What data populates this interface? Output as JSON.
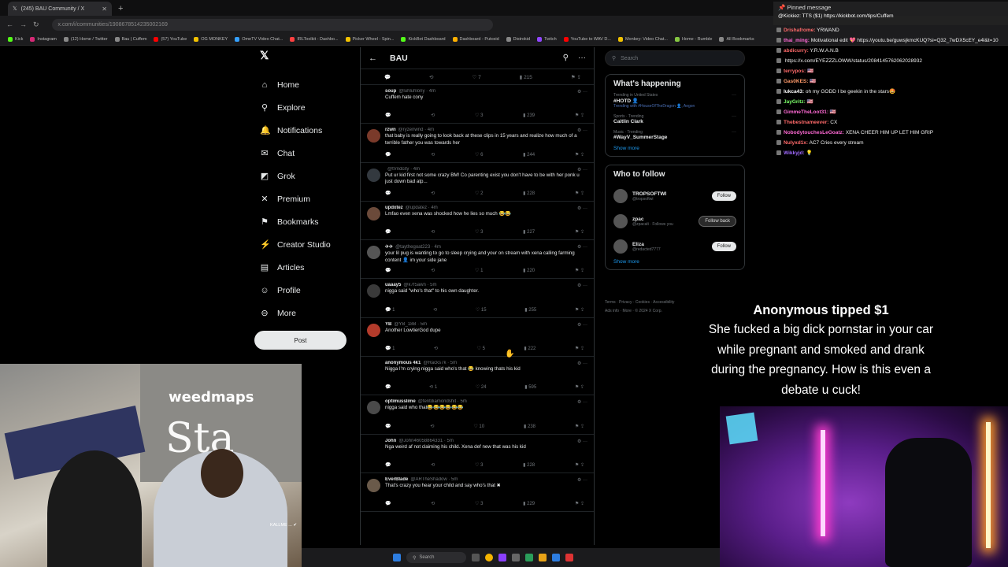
{
  "browser": {
    "tab_title": "(245) BAU Community / X",
    "address": "x.com/i/communities/1908678514235002169",
    "bookmarks": [
      {
        "label": "Kick",
        "color": "#53fc18"
      },
      {
        "label": "Instagram",
        "color": "#d62976"
      },
      {
        "label": "(12) Home / Twitter",
        "color": "#888888"
      },
      {
        "label": "Bau | Cuffem",
        "color": "#888888"
      },
      {
        "label": "(57) YouTube",
        "color": "#ff0000"
      },
      {
        "label": "OG MONKEY",
        "color": "#f2c200"
      },
      {
        "label": "OmeTV Video Chat...",
        "color": "#35a0ff"
      },
      {
        "label": "IRLToolkit - Dashbo...",
        "color": "#ff4040"
      },
      {
        "label": "Picker Wheel - Spin...",
        "color": "#f2c200"
      },
      {
        "label": "KickBot Dashboard",
        "color": "#53fc18"
      },
      {
        "label": "Dashboard - Putoxid",
        "color": "#ffb000"
      },
      {
        "label": "Distrokid",
        "color": "#888888"
      },
      {
        "label": "Twitch",
        "color": "#9146ff"
      },
      {
        "label": "YouTube to WAV D...",
        "color": "#ff0000"
      },
      {
        "label": "Monkey: Video Chat...",
        "color": "#f2c200"
      },
      {
        "label": "Home - Rumble",
        "color": "#85c742"
      },
      {
        "label": "All Bookmarks",
        "color": "#888888"
      }
    ]
  },
  "nav": {
    "items": [
      {
        "label": "Home",
        "icon": "home-icon",
        "glyph": "⌂"
      },
      {
        "label": "Explore",
        "icon": "search-icon",
        "glyph": "⚲"
      },
      {
        "label": "Notifications",
        "icon": "bell-icon",
        "glyph": "🔔"
      },
      {
        "label": "Chat",
        "icon": "chat-icon",
        "glyph": "✉"
      },
      {
        "label": "Grok",
        "icon": "grok-icon",
        "glyph": "◩"
      },
      {
        "label": "Premium",
        "icon": "premium-icon",
        "glyph": "✕"
      },
      {
        "label": "Bookmarks",
        "icon": "bookmark-icon",
        "glyph": "⚑"
      },
      {
        "label": "Creator Studio",
        "icon": "creator-icon",
        "glyph": "⚡"
      },
      {
        "label": "Articles",
        "icon": "articles-icon",
        "glyph": "▤"
      },
      {
        "label": "Profile",
        "icon": "profile-icon",
        "glyph": "☺"
      },
      {
        "label": "More",
        "icon": "more-icon",
        "glyph": "⊖"
      }
    ],
    "post_label": "Post"
  },
  "feed": {
    "title": "BAU",
    "tweets": [
      {
        "name": "soup",
        "handle": "@luhluhlony · 4m",
        "text": "Cuffem hate cony",
        "stats": [
          "",
          "",
          "3",
          "239"
        ],
        "avatar": "#000000"
      },
      {
        "name": "rzwn",
        "handle": "@ryzenwnd · 4m",
        "text": "that baby is really going to look back at these clips in 15 years and realize how much of a terrible father you was towards her",
        "stats": [
          "",
          "",
          "6",
          "244"
        ],
        "avatar": "#7a3a2a"
      },
      {
        "name": "",
        "handle": "@tVndcity · 4m",
        "text": "Put ur kid first not some crazy BM! Co parenting exist you don't have to be with her ponk u just down bad atp...",
        "stats": [
          "",
          "",
          "2",
          "228"
        ],
        "avatar": "#33393f"
      },
      {
        "name": "updxtez",
        "handle": "@updatez · 4m",
        "text": "Lmfao even xena was shocked how he lies so much 😂😂",
        "stats": [
          "",
          "",
          "3",
          "227"
        ],
        "avatar": "#6b4a3a"
      },
      {
        "name": "✈✈",
        "handle": "@taythegoat223 · 4m",
        "text": "your lil pug is wanting to go to sleep crying and your on stream with xena calling farming content 👤 im your side jane",
        "stats": [
          "",
          "",
          "1",
          "220"
        ],
        "avatar": "#555555"
      },
      {
        "name": "uaaay5",
        "handle": "@k7f5awn · 5m",
        "text": "nigga said \"who's that\" to his own daughter.",
        "stats": [
          "1",
          "",
          "15",
          "255"
        ],
        "avatar": "#3a3a3a"
      },
      {
        "name": "YB",
        "handle": "@YB_18B · 5m",
        "text": "Another LowtierGod dupe",
        "stats": [
          "1",
          "",
          "5",
          "222"
        ],
        "avatar": "#b33b2b"
      },
      {
        "name": "anonymous 4k1",
        "handle": "@Racks7k · 5m",
        "text": "Nigga I'm crying nigga said who's that 😂 knowing thats his kid",
        "stats": [
          "",
          "1",
          "24",
          "595"
        ],
        "avatar": "#000000"
      },
      {
        "name": "optimusslime",
        "handle": "@fentdiamondshit · 5m",
        "text": "nigga said who that😂😂😂😂😂😂",
        "stats": [
          "",
          "",
          "10",
          "238"
        ],
        "avatar": "#4a4a4a"
      },
      {
        "name": "John",
        "handle": "@John46058864331 · 5m",
        "text": "Nga weird af not claiming his child. Xena def new that was his kid",
        "stats": [
          "",
          "",
          "3",
          "228"
        ],
        "avatar": "#000000"
      },
      {
        "name": "EverBlade",
        "handle": "@ARTheShadow · 5m",
        "text": "That's crazy you hear your child and say who's that ✖",
        "stats": [
          "",
          "",
          "3",
          "229"
        ],
        "avatar": "#6a5a4a"
      }
    ],
    "top_stats": [
      "",
      "",
      "7",
      "215"
    ]
  },
  "right": {
    "search_placeholder": "Search",
    "whats_happening": "What's happening",
    "trends": [
      {
        "cat": "Trending in United States",
        "name": "#HOTD 👤",
        "sub": "Trending with #HouseOfTheDragon 👤, Aegon"
      },
      {
        "cat": "Sports · Trending",
        "name": "Caitlin Clark",
        "sub": ""
      },
      {
        "cat": "Music · Trending",
        "name": "#WayV_SummerStage",
        "sub": ""
      }
    ],
    "show_more": "Show more",
    "who_to_follow": "Who to follow",
    "follows": [
      {
        "name": "TROPSOFTWI",
        "handle": "@tropsoftwi",
        "button": "Follow",
        "back": false
      },
      {
        "name": "zpac",
        "handle": "@zpacalt · Follows you",
        "button": "Follow back",
        "back": true
      },
      {
        "name": "Eliza",
        "handle": "@redacted7777",
        "button": "Follow",
        "back": false
      }
    ],
    "show_more2": "Show more",
    "footer1": "Terms · Privacy · Cookies · Accessibility",
    "footer2": "Ads info · More · © 2024 X Corp."
  },
  "chat": {
    "pinned_title": "Pinned message",
    "pinned_text": "@Kickiez: TTS ($1) https://kickbot.com/tips/Cuffem",
    "messages": [
      {
        "user": "Drishafrome:",
        "text": "YRWAND",
        "color": "#ff6a6a"
      },
      {
        "user": "thai_ming:",
        "text": "Motivational edit 💖 https://youtu.be/guwsjkmcKUQ?si=Q32_7wDX5cEY_e4l&t=10",
        "color": "#ff6ad5"
      },
      {
        "user": "abdicurry:",
        "text": "Y.R.W.A.N.B",
        "color": "#ff6a6a"
      },
      {
        "user": "",
        "text": "https://x.com/EYEZZZLOWW/status/2084145762062028932",
        "color": "#ffffff"
      },
      {
        "user": "terrypos:",
        "text": "🇺🇸",
        "color": "#ff6a6a"
      },
      {
        "user": "Gas0KES:",
        "text": "🇺🇸",
        "color": "#ff9a6a"
      },
      {
        "user": "lukca43:",
        "text": "oh my GODD I be geekin in the stars🤩",
        "color": "#ffffff"
      },
      {
        "user": "JayGritz:",
        "text": "🇺🇸",
        "color": "#7cff6a"
      },
      {
        "user": "GimmeTheLoot31:",
        "text": "🇺🇸",
        "color": "#ff6ad5"
      },
      {
        "user": "Thebestnameever:",
        "text": "CX",
        "color": "#ff6a6a"
      },
      {
        "user": "NobodytouchesLeGoatz:",
        "text": "XENA CHEER HIM UP LET HIM GRIP",
        "color": "#ff6ad5"
      },
      {
        "user": "Nulyxd1x:",
        "text": "AC7 Cries every stream",
        "color": "#ff6a6a"
      },
      {
        "user": "Wikkyjd:",
        "text": "💡",
        "color": "#a06aff"
      }
    ]
  },
  "tip": {
    "title": "Anonymous tipped $1",
    "line1": "She fucked a big dick pornstar in your car",
    "line2": "while pregnant and smoked and drank",
    "line3": "during the pregnancy. How is this even a",
    "line4": "debate u cuck!"
  },
  "cam": {
    "sign_text": "weedmaps",
    "sign_big": "Sta",
    "caption": "KALLME ... ✔"
  },
  "taskbar": {
    "search": "Search"
  }
}
